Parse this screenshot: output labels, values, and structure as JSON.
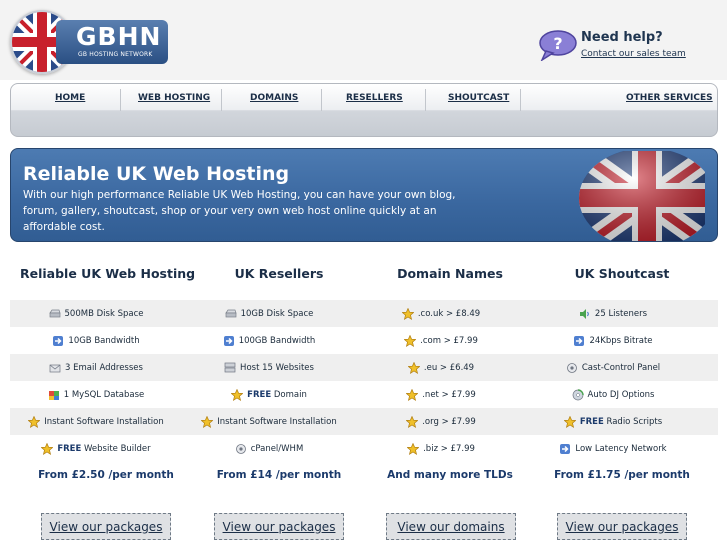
{
  "header": {
    "logo_name": "GBHN",
    "logo_sub": "GB HOSTING NETWORK",
    "help_title": "Need help?",
    "help_link": "Contact our sales team"
  },
  "nav": {
    "items": [
      "HOME",
      "WEB HOSTING",
      "DOMAINS",
      "RESELLERS",
      "SHOUTCAST",
      "OTHER SERVICES"
    ]
  },
  "banner": {
    "title": "Reliable UK Web Hosting",
    "text": "With our high performance Reliable UK Web Hosting, you can have your own blog, forum, gallery, shoutcast, shop or your very own web host online quickly at an affordable cost."
  },
  "columns": [
    {
      "title": "Reliable UK Web Hosting",
      "features": [
        {
          "icon": "disk-icon",
          "bold": "",
          "text": "500MB Disk Space"
        },
        {
          "icon": "arrow-icon",
          "bold": "",
          "text": "10GB Bandwidth"
        },
        {
          "icon": "email-icon",
          "bold": "",
          "text": "3 Email Addresses"
        },
        {
          "icon": "database-icon",
          "bold": "",
          "text": "1 MySQL Database"
        },
        {
          "icon": "star-icon",
          "bold": "",
          "text": "Instant Software Installation"
        },
        {
          "icon": "star-icon",
          "bold": "FREE",
          "text": " Website Builder"
        }
      ],
      "price": "From £2.50 /per month",
      "button": "View our packages"
    },
    {
      "title": "UK Resellers",
      "features": [
        {
          "icon": "disk-icon",
          "bold": "",
          "text": "10GB Disk Space"
        },
        {
          "icon": "arrow-icon",
          "bold": "",
          "text": "100GB Bandwidth"
        },
        {
          "icon": "server-icon",
          "bold": "",
          "text": "Host 15 Websites"
        },
        {
          "icon": "star-icon",
          "bold": "FREE",
          "text": " Domain"
        },
        {
          "icon": "star-icon",
          "bold": "",
          "text": "Instant Software Installation"
        },
        {
          "icon": "cpanel-icon",
          "bold": "",
          "text": "cPanel/WHM"
        }
      ],
      "price": "From £14 /per month",
      "button": "View our packages"
    },
    {
      "title": "Domain Names",
      "features": [
        {
          "icon": "star-icon",
          "bold": "",
          "text": ".co.uk > £8.49"
        },
        {
          "icon": "star-icon",
          "bold": "",
          "text": ".com > £7.99"
        },
        {
          "icon": "star-icon",
          "bold": "",
          "text": ".eu > £6.49"
        },
        {
          "icon": "star-icon",
          "bold": "",
          "text": ".net > £7.99"
        },
        {
          "icon": "star-icon",
          "bold": "",
          "text": ".org > £7.99"
        },
        {
          "icon": "star-icon",
          "bold": "",
          "text": ".biz > £7.99"
        }
      ],
      "price": "And many more TLDs",
      "button": "View our domains"
    },
    {
      "title": "UK Shoutcast",
      "features": [
        {
          "icon": "speaker-icon",
          "bold": "",
          "text": "25 Listeners"
        },
        {
          "icon": "arrow-icon",
          "bold": "",
          "text": "24Kbps Bitrate"
        },
        {
          "icon": "cpanel-icon",
          "bold": "",
          "text": "Cast-Control Panel"
        },
        {
          "icon": "disc-icon",
          "bold": "",
          "text": "Auto DJ Options"
        },
        {
          "icon": "star-icon",
          "bold": "FREE",
          "text": " Radio Scripts"
        },
        {
          "icon": "arrow-icon",
          "bold": "",
          "text": "Low Latency Network"
        }
      ],
      "price": "From £1.75 /per month",
      "button": "View our packages"
    }
  ],
  "colors": {
    "banner_blue": "#3a679f",
    "nav_text": "#1b2e47",
    "accent_text": "#1b3a6b",
    "row_alt": "#efefef"
  }
}
